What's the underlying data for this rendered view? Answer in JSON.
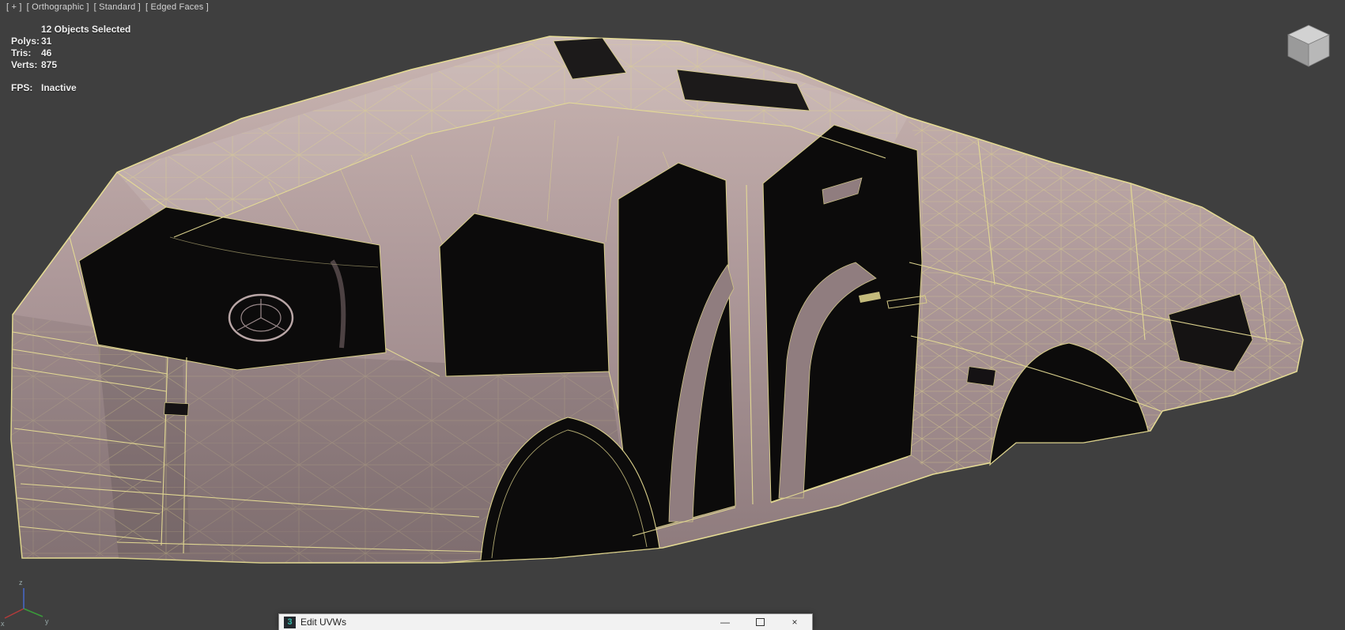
{
  "viewport": {
    "label_segments": [
      {
        "label": "[ + ]"
      },
      {
        "label": "[ Orthographic ]"
      },
      {
        "label": "[ Standard ]"
      },
      {
        "label": "[ Edged Faces ]"
      }
    ],
    "stats": {
      "selection": "12 Objects Selected",
      "rows": [
        {
          "label": "Polys:",
          "value": "31"
        },
        {
          "label": "Tris:",
          "value": "46"
        },
        {
          "label": "Verts:",
          "value": "875"
        }
      ],
      "fps": {
        "label": "FPS:",
        "value": "Inactive"
      }
    },
    "axis_labels": [
      "x",
      "y",
      "z"
    ]
  },
  "edit_uvws_window": {
    "title": "Edit UVWs",
    "icon": "3",
    "controls": {
      "minimize": "—",
      "close": "×"
    }
  },
  "icons": {
    "app_icon": "3ds-max-icon",
    "viewcube": "view-cube",
    "world_axis": "world-axis-tripod",
    "minimize": "minimize-icon",
    "maximize": "maximize-icon",
    "close": "close-icon"
  },
  "colors": {
    "viewport_background": "#3f3f3f",
    "wireframe_edges": "#e6dc94",
    "model_surface": "#ae999a",
    "openings": "#0c0b0b",
    "titlebar_background": "#f2f2f2"
  }
}
